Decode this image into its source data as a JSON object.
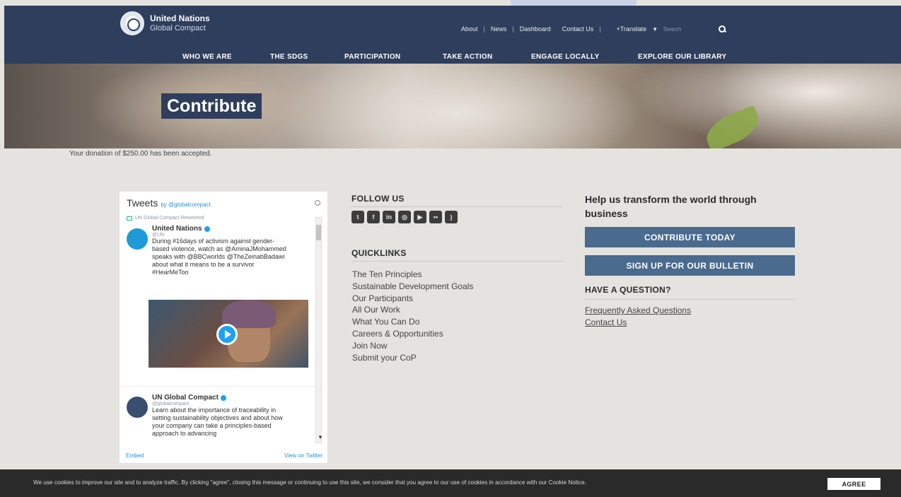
{
  "header": {
    "logo_line1": "United Nations",
    "logo_line2": "Global Compact",
    "utility": [
      "About",
      "News",
      "Dashboard",
      "Contact Us"
    ],
    "translate": "+Translate",
    "search_placeholder": "Search"
  },
  "nav": [
    "WHO WE ARE",
    "THE SDGS",
    "PARTICIPATION",
    "TAKE ACTION",
    "ENGAGE LOCALLY",
    "EXPLORE OUR LIBRARY"
  ],
  "hero": {
    "title": "Contribute"
  },
  "donation_message": "Your donation of $250.00 has been accepted.",
  "twitter": {
    "title": "Tweets",
    "by": "by @globalcompact",
    "tweet1": {
      "retweet": "UN Global Compact Retweeted",
      "name": "United Nations",
      "handle": "@UN",
      "text": "During #16days of activism against gender-based violence, watch as @AminaJMohammed speaks with @BBCworlds @TheZeinabBadawi about what it means to be a survivor #HearMeToo"
    },
    "tweet2": {
      "name": "UN Global Compact",
      "handle": "@globalcompact",
      "text": "Learn about the importance of traceability in setting sustainability objectives and about how your company can take a principles-based approach to advancing"
    },
    "embed": "Embed",
    "view": "View on Twitter"
  },
  "follow_title": "FOLLOW US",
  "social_icons": [
    {
      "name": "twitter-icon",
      "glyph": "t"
    },
    {
      "name": "facebook-icon",
      "glyph": "f"
    },
    {
      "name": "linkedin-icon",
      "glyph": "in"
    },
    {
      "name": "instagram-icon",
      "glyph": "◎"
    },
    {
      "name": "youtube-icon",
      "glyph": "▶"
    },
    {
      "name": "flickr-icon",
      "glyph": "••"
    },
    {
      "name": "rss-icon",
      "glyph": ")"
    }
  ],
  "quicklinks_title": "QUICKLINKS",
  "quicklinks": [
    "The Ten Principles",
    "Sustainable Development Goals",
    "Our Participants",
    "All Our Work",
    "What You Can Do",
    "Careers & Opportunities",
    "Join Now",
    "Submit your CoP"
  ],
  "help_title": "Help us transform the world through business",
  "cta1": "CONTRIBUTE TODAY",
  "cta2": "SIGN UP FOR OUR BULLETIN",
  "question_title": "HAVE A QUESTION?",
  "faq": "Frequently Asked Questions",
  "contact": "Contact Us",
  "cookie_text": "We use cookies to improve our site and to analyze traffic. By clicking \"agree\", closing this message or continuing to use this site, we consider that you agree to our use of cookies in accordance with our Cookie Notice.",
  "agree": "AGREE",
  "colors": {
    "header": "#2e3e5c",
    "cta": "#4a6a8e",
    "cookie_bar": "#2a2a2a"
  }
}
